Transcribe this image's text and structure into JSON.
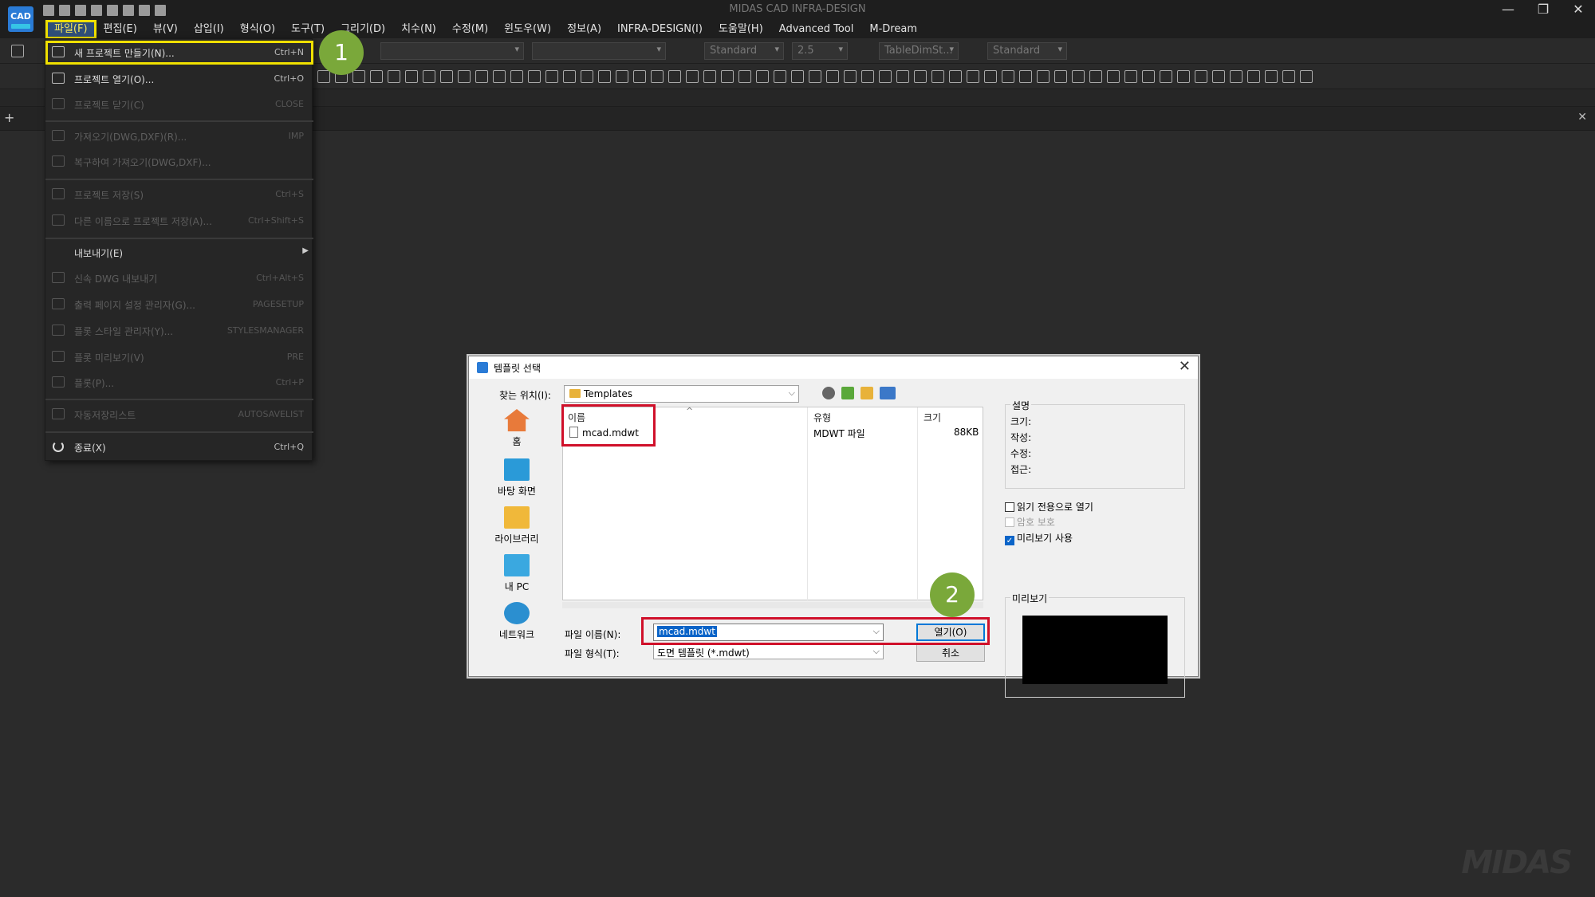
{
  "app": {
    "logo_text": "CAD",
    "window_title": "MIDAS CAD INFRA-DESIGN",
    "brand": "MIDAS"
  },
  "window_controls": {
    "minimize": "—",
    "restore": "❐",
    "close": "✕"
  },
  "menu": [
    "파일(F)",
    "편집(E)",
    "뷰(V)",
    "삽입(I)",
    "형식(O)",
    "도구(T)",
    "그리기(D)",
    "치수(N)",
    "수정(M)",
    "윈도우(W)",
    "정보(A)",
    "INFRA-DESIGN(I)",
    "도움말(H)",
    "Advanced Tool",
    "M-Dream"
  ],
  "toolbar": {
    "text_style": "Standard",
    "text_height": "2.5",
    "dim_style": "TableDimSt...",
    "multileader_style": "Standard"
  },
  "file_menu": {
    "items": [
      {
        "label": "새 프로젝트 만들기(N)...",
        "shortcut": "Ctrl+N",
        "enabled": true
      },
      {
        "label": "프로젝트 열기(O)...",
        "shortcut": "Ctrl+O",
        "enabled": true
      },
      {
        "label": "프로젝트 닫기(C)",
        "shortcut": "CLOSE",
        "enabled": false
      },
      {
        "label": "가져오기(DWG,DXF)(R)...",
        "shortcut": "IMP",
        "enabled": false
      },
      {
        "label": "복구하여 가져오기(DWG,DXF)...",
        "shortcut": "",
        "enabled": false
      },
      {
        "label": "프로젝트 저장(S)",
        "shortcut": "Ctrl+S",
        "enabled": false
      },
      {
        "label": "다른 이름으로 프로젝트 저장(A)...",
        "shortcut": "Ctrl+Shift+S",
        "enabled": false
      },
      {
        "label": "내보내기(E)",
        "shortcut": "",
        "enabled": true
      },
      {
        "label": "신속 DWG 내보내기",
        "shortcut": "Ctrl+Alt+S",
        "enabled": false
      },
      {
        "label": "출력 페이지 설정 관리자(G)...",
        "shortcut": "PAGESETUP",
        "enabled": false
      },
      {
        "label": "플롯 스타일 관리자(Y)...",
        "shortcut": "STYLESMANAGER",
        "enabled": false
      },
      {
        "label": "플롯 미리보기(V)",
        "shortcut": "PRE",
        "enabled": false
      },
      {
        "label": "플롯(P)...",
        "shortcut": "Ctrl+P",
        "enabled": false
      },
      {
        "label": "자동저장리스트",
        "shortcut": "AUTOSAVELIST",
        "enabled": false
      },
      {
        "label": "종료(X)",
        "shortcut": "Ctrl+Q",
        "enabled": true
      }
    ]
  },
  "callouts": [
    "1",
    "2"
  ],
  "dialog": {
    "title": "템플릿 선택",
    "look_in_label": "찾는 위치(I):",
    "look_in_value": "Templates",
    "places": [
      "홈",
      "바탕 화면",
      "라이브러리",
      "내 PC",
      "네트워크"
    ],
    "columns": [
      "이름",
      "유형",
      "크기"
    ],
    "files": [
      {
        "name": "mcad.mdwt",
        "type": "MDWT 파일",
        "size": "88KB"
      }
    ],
    "filename_label": "파일 이름(N):",
    "filename_value": "mcad.mdwt",
    "filetype_label": "파일 형식(T):",
    "filetype_value": "도면 템플릿 (*.mdwt)",
    "open_button": "열기(O)",
    "cancel_button": "취소",
    "description_title": "설명",
    "description_fields": [
      "크기:",
      "작성:",
      "수정:",
      "접근:"
    ],
    "checkboxes": [
      {
        "label": "읽기 전용으로 열기",
        "checked": false,
        "enabled": true
      },
      {
        "label": "암호 보호",
        "checked": false,
        "enabled": false
      },
      {
        "label": "미리보기 사용",
        "checked": true,
        "enabled": true
      }
    ],
    "preview_title": "미리보기"
  },
  "colors": {
    "highlight_yellow": "#f0e000",
    "annotation_red": "#d0102a",
    "callout_green": "#7aa83a"
  }
}
